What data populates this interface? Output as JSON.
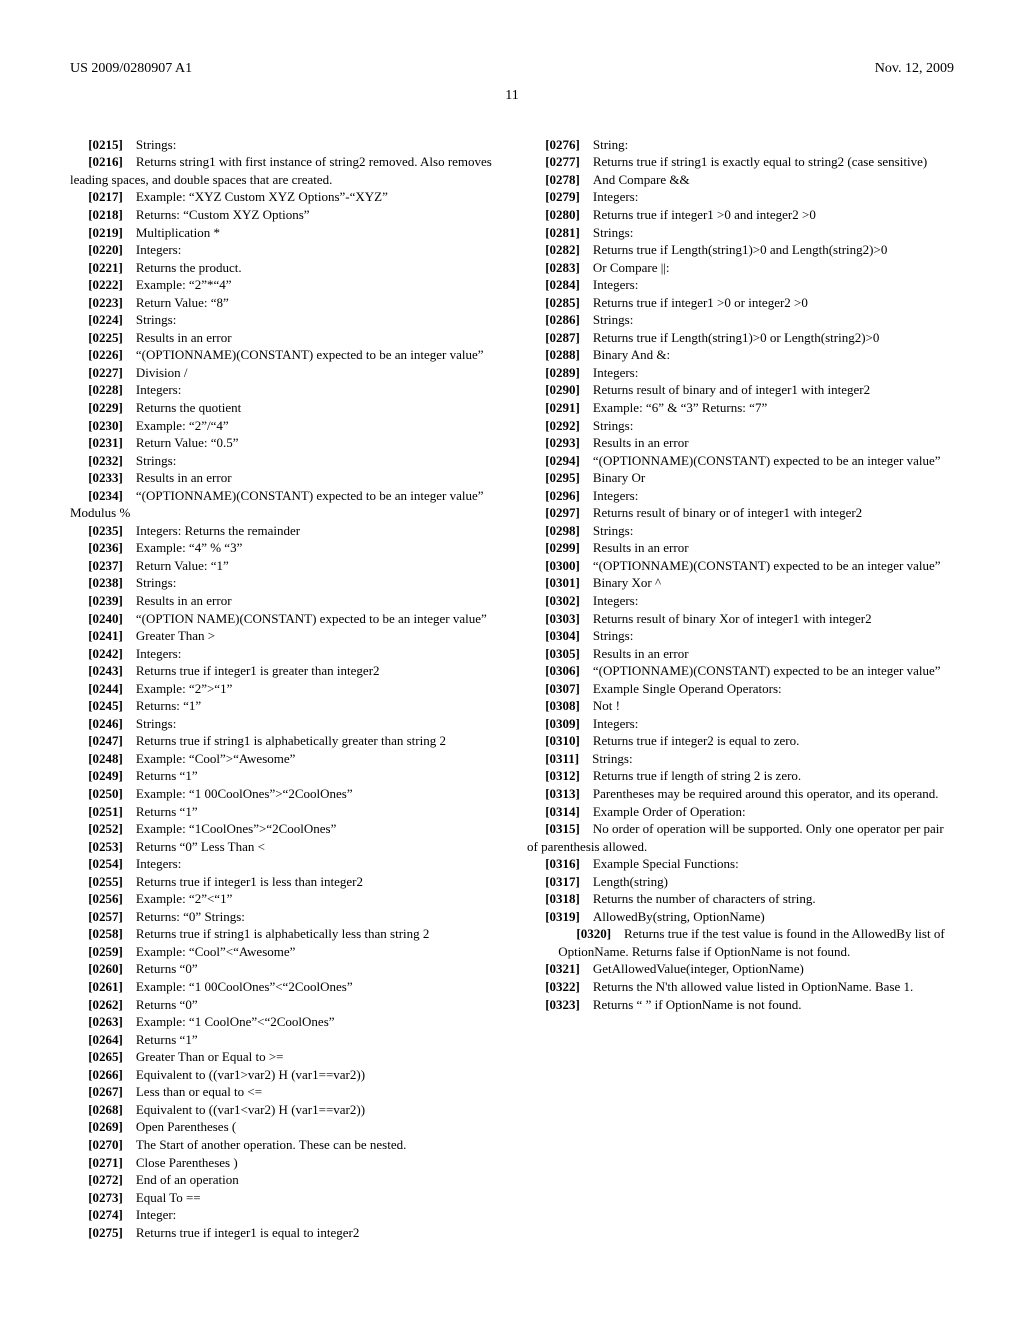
{
  "header": {
    "left": "US 2009/0280907 A1",
    "right": "Nov. 12, 2009"
  },
  "page_number": "11",
  "items": [
    {
      "n": "[0215]",
      "t": "Strings:"
    },
    {
      "n": "[0216]",
      "t": "Returns string1 with first instance of string2 removed. Also removes leading spaces, and double spaces that are created."
    },
    {
      "n": "[0217]",
      "t": "Example: “XYZ Custom XYZ Options”-“XYZ”"
    },
    {
      "n": "[0218]",
      "t": "Returns: “Custom XYZ Options”"
    },
    {
      "n": "[0219]",
      "t": "Multiplication *"
    },
    {
      "n": "[0220]",
      "t": "Integers:"
    },
    {
      "n": "[0221]",
      "t": "Returns the product."
    },
    {
      "n": "[0222]",
      "t": "Example: “2”*“4”"
    },
    {
      "n": "[0223]",
      "t": "Return Value: “8”"
    },
    {
      "n": "[0224]",
      "t": "Strings:"
    },
    {
      "n": "[0225]",
      "t": "Results in an error"
    },
    {
      "n": "[0226]",
      "t": "“(OPTIONNAME)(CONSTANT) expected to be an integer value”"
    },
    {
      "n": "[0227]",
      "t": "Division /"
    },
    {
      "n": "[0228]",
      "t": "Integers:"
    },
    {
      "n": "[0229]",
      "t": "Returns the quotient"
    },
    {
      "n": "[0230]",
      "t": "Example: “2”/“4”"
    },
    {
      "n": "[0231]",
      "t": "Return Value: “0.5”"
    },
    {
      "n": "[0232]",
      "t": "Strings:"
    },
    {
      "n": "[0233]",
      "t": "Results in an error"
    },
    {
      "n": "[0234]",
      "t": "“(OPTIONNAME)(CONSTANT) expected to be an integer value” Modulus %"
    },
    {
      "n": "[0235]",
      "t": "Integers: Returns the remainder"
    },
    {
      "n": "[0236]",
      "t": "Example: “4” % “3”"
    },
    {
      "n": "[0237]",
      "t": "Return Value: “1”"
    },
    {
      "n": "[0238]",
      "t": "Strings:"
    },
    {
      "n": "[0239]",
      "t": "Results in an error"
    },
    {
      "n": "[0240]",
      "t": "“(OPTION NAME)(CONSTANT) expected to be an integer value”"
    },
    {
      "n": "[0241]",
      "t": "Greater Than >"
    },
    {
      "n": "[0242]",
      "t": "Integers:"
    },
    {
      "n": "[0243]",
      "t": "Returns true if integer1 is greater than integer2"
    },
    {
      "n": "[0244]",
      "t": "Example: “2”>“1”"
    },
    {
      "n": "[0245]",
      "t": "Returns: “1”"
    },
    {
      "n": "[0246]",
      "t": "Strings:"
    },
    {
      "n": "[0247]",
      "t": "Returns true if string1 is alphabetically greater than string 2"
    },
    {
      "n": "[0248]",
      "t": "Example: “Cool”>“Awesome”"
    },
    {
      "n": "[0249]",
      "t": "Returns “1”"
    },
    {
      "n": "[0250]",
      "t": "Example: “1 00CoolOnes”>“2CoolOnes”"
    },
    {
      "n": "[0251]",
      "t": "Returns “1”"
    },
    {
      "n": "[0252]",
      "t": "Example: “1CoolOnes”>“2CoolOnes”"
    },
    {
      "n": "[0253]",
      "t": "Returns “0” Less Than <"
    },
    {
      "n": "[0254]",
      "t": "Integers:"
    },
    {
      "n": "[0255]",
      "t": "Returns true if integer1 is less than integer2"
    },
    {
      "n": "[0256]",
      "t": "Example: “2”<“1”"
    },
    {
      "n": "[0257]",
      "t": "Returns: “0” Strings:"
    },
    {
      "n": "[0258]",
      "t": "Returns true if string1 is alphabetically less than string 2"
    },
    {
      "n": "[0259]",
      "t": "Example: “Cool”<“Awesome”"
    },
    {
      "n": "[0260]",
      "t": "Returns “0”"
    },
    {
      "n": "[0261]",
      "t": "Example: “1 00CoolOnes”<“2CoolOnes”"
    },
    {
      "n": "[0262]",
      "t": "Returns “0”"
    },
    {
      "n": "[0263]",
      "t": "Example: “1 CoolOne”<“2CoolOnes”"
    },
    {
      "n": "[0264]",
      "t": "Returns “1”"
    },
    {
      "n": "[0265]",
      "t": "Greater Than or Equal to >="
    },
    {
      "n": "[0266]",
      "t": "Equivalent to ((var1>var2) H (var1==var2))"
    },
    {
      "n": "[0267]",
      "t": "Less than or equal to <="
    },
    {
      "n": "[0268]",
      "t": "Equivalent to ((var1<var2) H (var1==var2))"
    },
    {
      "n": "[0269]",
      "t": "Open Parentheses ("
    },
    {
      "n": "[0270]",
      "t": "The Start of another operation. These can be nested."
    },
    {
      "n": "[0271]",
      "t": "Close Parentheses )"
    },
    {
      "n": "[0272]",
      "t": "End of an operation"
    },
    {
      "n": "[0273]",
      "t": "Equal To =="
    },
    {
      "n": "[0274]",
      "t": "Integer:"
    },
    {
      "n": "[0275]",
      "t": "Returns true if integer1 is equal to integer2"
    },
    {
      "n": "[0276]",
      "t": "String:"
    },
    {
      "n": "[0277]",
      "t": "Returns true if string1 is exactly equal to string2 (case sensitive)"
    },
    {
      "n": "[0278]",
      "t": "And Compare &&"
    },
    {
      "n": "[0279]",
      "t": "Integers:"
    },
    {
      "n": "[0280]",
      "t": "Returns true if integer1 >0 and integer2 >0"
    },
    {
      "n": "[0281]",
      "t": "Strings:"
    },
    {
      "n": "[0282]",
      "t": "Returns true if Length(string1)>0 and Length(string2)>0"
    },
    {
      "n": "[0283]",
      "t": "Or Compare ||:"
    },
    {
      "n": "[0284]",
      "t": "Integers:"
    },
    {
      "n": "[0285]",
      "t": "Returns true if integer1 >0 or integer2 >0"
    },
    {
      "n": "[0286]",
      "t": "Strings:"
    },
    {
      "n": "[0287]",
      "t": "Returns true if Length(string1)>0 or Length(string2)>0"
    },
    {
      "n": "[0288]",
      "t": "Binary And &:"
    },
    {
      "n": "[0289]",
      "t": "Integers:"
    },
    {
      "n": "[0290]",
      "t": "Returns result of binary and of integer1 with integer2"
    },
    {
      "n": "[0291]",
      "t": "Example: “6” & “3” Returns: “7”"
    },
    {
      "n": "[0292]",
      "t": "Strings:"
    },
    {
      "n": "[0293]",
      "t": "Results in an error"
    },
    {
      "n": "[0294]",
      "t": "“(OPTIONNAME)(CONSTANT) expected to be an integer value”"
    },
    {
      "n": "[0295]",
      "t": "Binary Or"
    },
    {
      "n": "[0296]",
      "t": "Integers:"
    },
    {
      "n": "[0297]",
      "t": "Returns result of binary or of integer1 with integer2"
    },
    {
      "n": "[0298]",
      "t": "Strings:"
    },
    {
      "n": "[0299]",
      "t": "Results in an error"
    },
    {
      "n": "[0300]",
      "t": "“(OPTIONNAME)(CONSTANT) expected to be an integer value”"
    },
    {
      "n": "[0301]",
      "t": "Binary Xor ^"
    },
    {
      "n": "[0302]",
      "t": "Integers:"
    },
    {
      "n": "[0303]",
      "t": "Returns result of binary Xor of integer1 with integer2"
    },
    {
      "n": "[0304]",
      "t": "Strings:"
    },
    {
      "n": "[0305]",
      "t": "Results in an error"
    },
    {
      "n": "[0306]",
      "t": "“(OPTIONNAME)(CONSTANT) expected to be an integer value”"
    },
    {
      "n": "[0307]",
      "t": "Example Single Operand Operators:"
    },
    {
      "n": "[0308]",
      "t": "Not !"
    },
    {
      "n": "[0309]",
      "t": "Integers:"
    },
    {
      "n": "[0310]",
      "t": "Returns true if integer2 is equal to zero."
    },
    {
      "n": "[0311]",
      "t": "Strings:"
    },
    {
      "n": "[0312]",
      "t": "Returns true if length of string 2 is zero."
    },
    {
      "n": "[0313]",
      "t": "Parentheses may be required around this operator, and its operand."
    },
    {
      "n": "[0314]",
      "t": "Example Order of Operation:"
    },
    {
      "n": "[0315]",
      "t": "No order of operation will be supported. Only one operator per pair of parenthesis allowed."
    },
    {
      "n": "[0316]",
      "t": "Example Special Functions:"
    },
    {
      "n": "[0317]",
      "t": "Length(string)"
    },
    {
      "n": "[0318]",
      "t": "Returns the number of characters of string."
    },
    {
      "n": "[0319]",
      "t": "AllowedBy(string, OptionName)"
    },
    {
      "n": "[0320]",
      "t": "Returns true if the test value is found in the AllowedBy list of OptionName. Returns false if OptionName is not found.",
      "indent": true
    },
    {
      "n": "[0321]",
      "t": "GetAllowedValue(integer, OptionName)"
    },
    {
      "n": "[0322]",
      "t": "Returns the N'th allowed value listed in OptionName. Base 1."
    },
    {
      "n": "[0323]",
      "t": "Returns “ ” if OptionName is not found."
    }
  ]
}
